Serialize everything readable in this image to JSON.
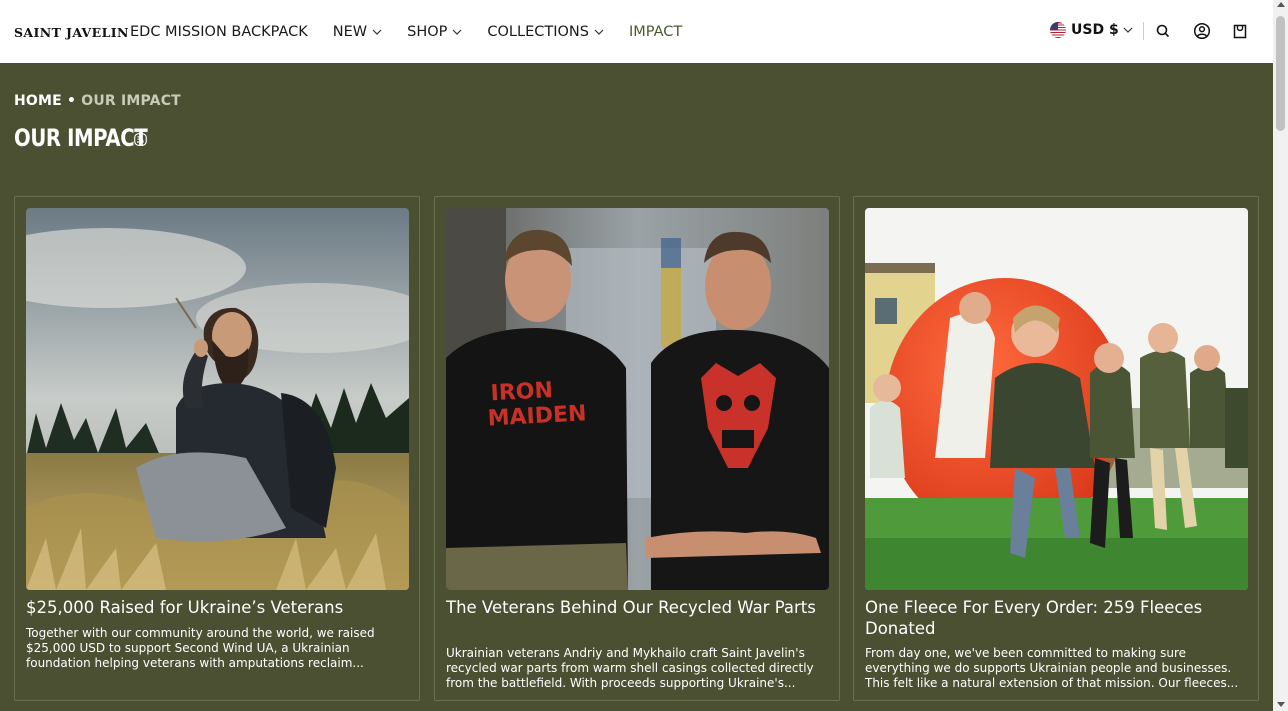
{
  "header": {
    "logo": "SAINT JAVELIN",
    "nav": [
      {
        "label": "EDC MISSION BACKPACK",
        "dropdown": false
      },
      {
        "label": "NEW",
        "dropdown": true
      },
      {
        "label": "SHOP",
        "dropdown": true
      },
      {
        "label": "COLLECTIONS",
        "dropdown": true
      },
      {
        "label": "IMPACT",
        "dropdown": false,
        "active": true
      }
    ],
    "currency": "USD $",
    "icons": [
      "search-icon",
      "account-icon",
      "cart-icon"
    ]
  },
  "breadcrumb": {
    "home": "HOME",
    "separator": " • ",
    "current": "OUR IMPACT"
  },
  "page_title": "OUR IMPACT",
  "cards": [
    {
      "title": "$25,000 Raised for Ukraine’s Veterans",
      "excerpt": "Together with our community around the world, we raised $25,000 USD to support Second Wind UA, a Ukrainian foundation helping veterans with amputations reclaim..."
    },
    {
      "title": "The Veterans Behind Our Recycled War Parts",
      "excerpt": "Ukrainian veterans Andriy and Mykhailo craft Saint Javelin's recycled war parts from warm shell casings collected directly from the battlefield. With proceeds supporting Ukraine's..."
    },
    {
      "title": "One Fleece For Every Order: 259 Fleeces Donated",
      "excerpt": "From day one, we've been committed to making sure everything we do supports Ukrainian people and businesses. This felt like a natural extension of that mission. Our fleeces..."
    }
  ],
  "colors": {
    "background": "#4b5032",
    "header_bg": "#ffffff",
    "active_nav": "#4a5a2e"
  }
}
